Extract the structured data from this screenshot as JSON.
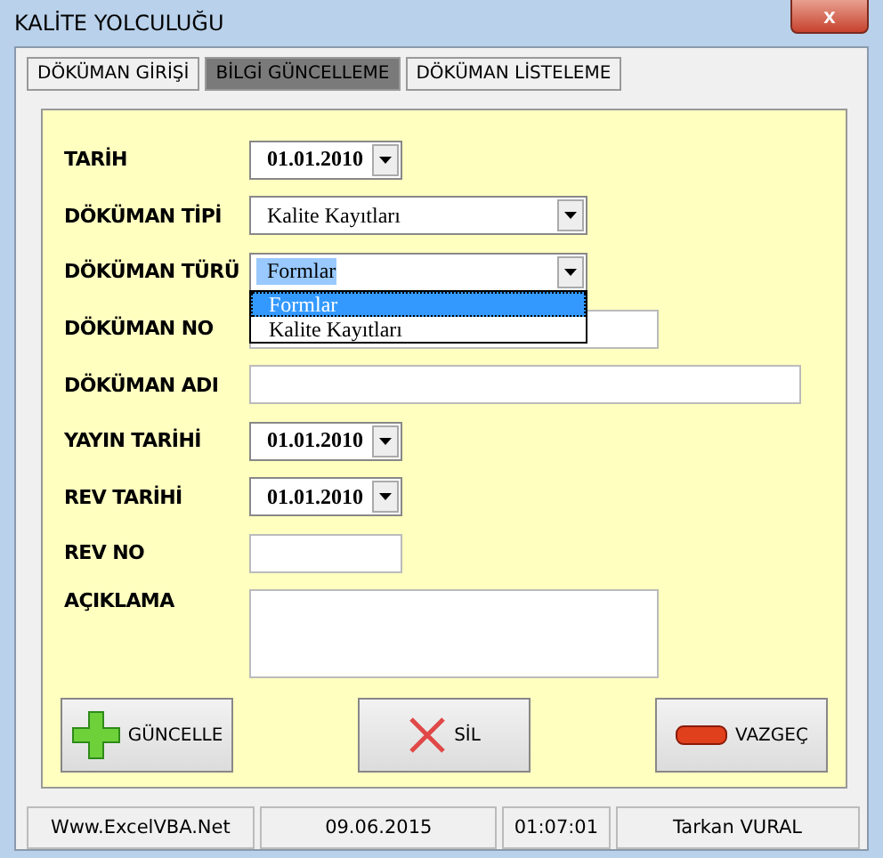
{
  "window": {
    "title": "KALİTE YOLCULUĞU",
    "close": "x"
  },
  "tabs": [
    {
      "label": "DÖKÜMAN GİRİŞİ",
      "selected": false
    },
    {
      "label": "BİLGİ GÜNCELLEME",
      "selected": true
    },
    {
      "label": "DÖKÜMAN LİSTELEME",
      "selected": false
    }
  ],
  "fields": [
    {
      "label": "TARİH",
      "kind": "date",
      "value": "01.01.2010"
    },
    {
      "label": "DÖKÜMAN TİPİ",
      "kind": "combo",
      "value": "Kalite Kayıtları"
    },
    {
      "label": "DÖKÜMAN TÜRÜ",
      "kind": "combo",
      "value": "Formlar",
      "expanded": true,
      "options": [
        {
          "text": "Formlar",
          "selected": true
        },
        {
          "text": "Kalite Kayıtları",
          "selected": false
        }
      ]
    },
    {
      "label": "DÖKÜMAN NO",
      "kind": "short"
    },
    {
      "label": "DÖKÜMAN ADI",
      "kind": "long"
    },
    {
      "label": "YAYIN TARİHİ",
      "kind": "date",
      "value": "01.01.2010"
    },
    {
      "label": "REV TARİHİ",
      "kind": "date",
      "value": "01.01.2010"
    },
    {
      "label": "REV NO",
      "kind": "tiny"
    },
    {
      "label": "AÇIKLAMA",
      "kind": "area"
    }
  ],
  "buttons": [
    {
      "label": "GÜNCELLE",
      "kind": "add"
    },
    {
      "label": "SİL",
      "kind": "delete"
    },
    {
      "label": "VAZGEÇ",
      "kind": "cancel"
    }
  ],
  "status_bar": [
    "Www.ExcelVBA.Net",
    "09.06.2015",
    "01:07:01",
    "Tarkan VURAL"
  ]
}
